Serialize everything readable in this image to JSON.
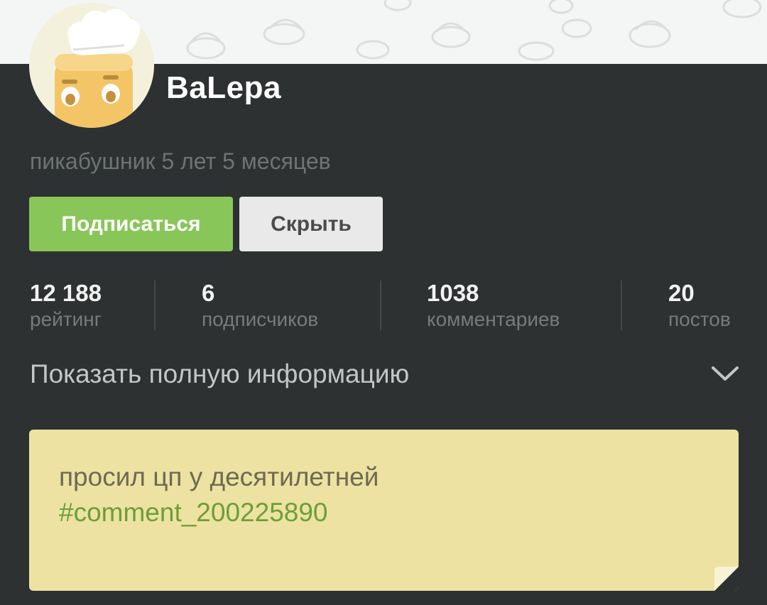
{
  "profile": {
    "username": "BaLepa",
    "member_since": "пикабушник 5 лет 5 месяцев"
  },
  "actions": {
    "subscribe_label": "Подписаться",
    "hide_label": "Скрыть"
  },
  "stats": [
    {
      "value": "12 188",
      "label": "рейтинг"
    },
    {
      "value": "6",
      "label": "подписчиков"
    },
    {
      "value": "1038",
      "label": "комментариев"
    },
    {
      "value": "20",
      "label": "постов"
    }
  ],
  "info": {
    "show_full_label": "Показать полную информацию"
  },
  "note": {
    "text": "просил цп у десятилетней",
    "link": "#comment_200225890"
  },
  "colors": {
    "panel_bg": "#2e3131",
    "subscribe_bg": "#88c659",
    "hide_bg": "#e9e9e9",
    "note_bg": "#ede2a1",
    "link_color": "#6c9e3b"
  },
  "icons": {
    "avatar": "toast-chef-icon",
    "expand": "chevron-down-icon",
    "note_corner": "folded-corner-icon"
  }
}
